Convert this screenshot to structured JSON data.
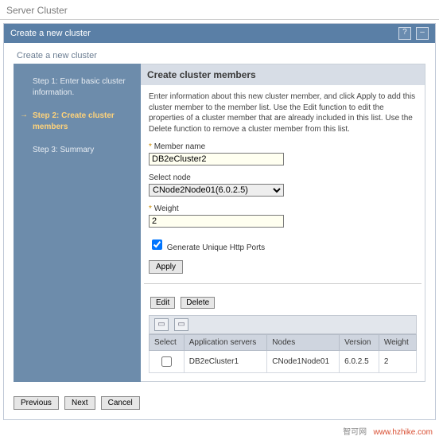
{
  "page": {
    "outer_title": "Server Cluster",
    "panel_title": "Create a new cluster",
    "subtitle": "Create a new cluster"
  },
  "steps": {
    "s1": "Step 1: Enter basic cluster information.",
    "s2": "Step 2: Create cluster members",
    "s3": "Step 3: Summary"
  },
  "content": {
    "header": "Create cluster members",
    "instructions": "Enter information about this new cluster member, and click Apply to add this cluster member to the member list. Use the Edit function to edit the properties of a cluster member that are already included in this list. Use the Delete function to remove a cluster member from this list."
  },
  "fields": {
    "member_name_label": "Member name",
    "member_name_value": "DB2eCluster2",
    "select_node_label": "Select node",
    "select_node_value": "CNode2Node01(6.0.2.5)",
    "weight_label": "Weight",
    "weight_value": "2",
    "gen_ports_label": "Generate Unique Http Ports"
  },
  "buttons": {
    "apply": "Apply",
    "edit": "Edit",
    "delete": "Delete",
    "previous": "Previous",
    "next": "Next",
    "cancel": "Cancel"
  },
  "table": {
    "headers": {
      "select": "Select",
      "appservers": "Application servers",
      "nodes": "Nodes",
      "version": "Version",
      "weight": "Weight"
    },
    "row1": {
      "appservers": "DB2eCluster1",
      "nodes": "CNode1Node01",
      "version": "6.0.2.5",
      "weight": "2"
    }
  },
  "watermark": {
    "cn": "智可网",
    "url": "www.hzhike.com"
  }
}
